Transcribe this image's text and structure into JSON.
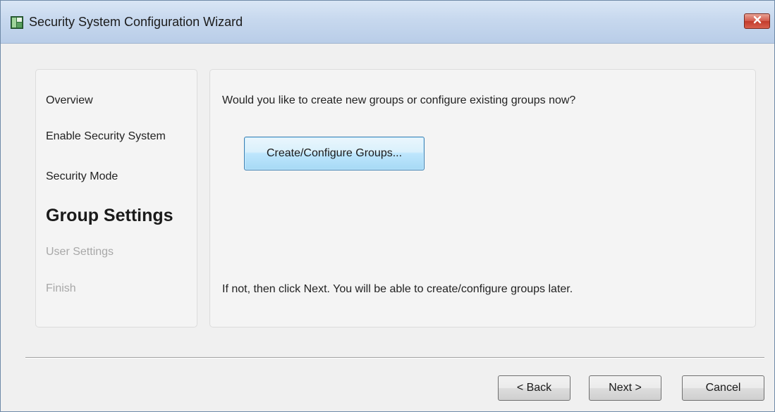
{
  "window": {
    "title": "Security System Configuration Wizard"
  },
  "nav": {
    "items": [
      {
        "label": "Overview",
        "state": "normal"
      },
      {
        "label": "Enable Security System",
        "state": "normal"
      },
      {
        "label": "Security Mode",
        "state": "normal"
      },
      {
        "label": "Group Settings",
        "state": "current"
      },
      {
        "label": "User Settings",
        "state": "disabled"
      },
      {
        "label": "Finish",
        "state": "disabled"
      }
    ]
  },
  "content": {
    "question": "Would you like to create new groups or configure existing groups now?",
    "create_button_label": "Create/Configure Groups...",
    "hint": "If not, then click Next. You will be able to create/configure groups later."
  },
  "footer": {
    "back_label": "< Back",
    "next_label": "Next >",
    "cancel_label": "Cancel"
  },
  "icons": {
    "app": "wizard-app-icon",
    "close": "close-icon"
  },
  "colors": {
    "titlebar": "#c7d8ee",
    "close_button": "#c23b2c",
    "primary_button_border": "#3c7fb1",
    "disabled_text": "#a8a8a8"
  }
}
